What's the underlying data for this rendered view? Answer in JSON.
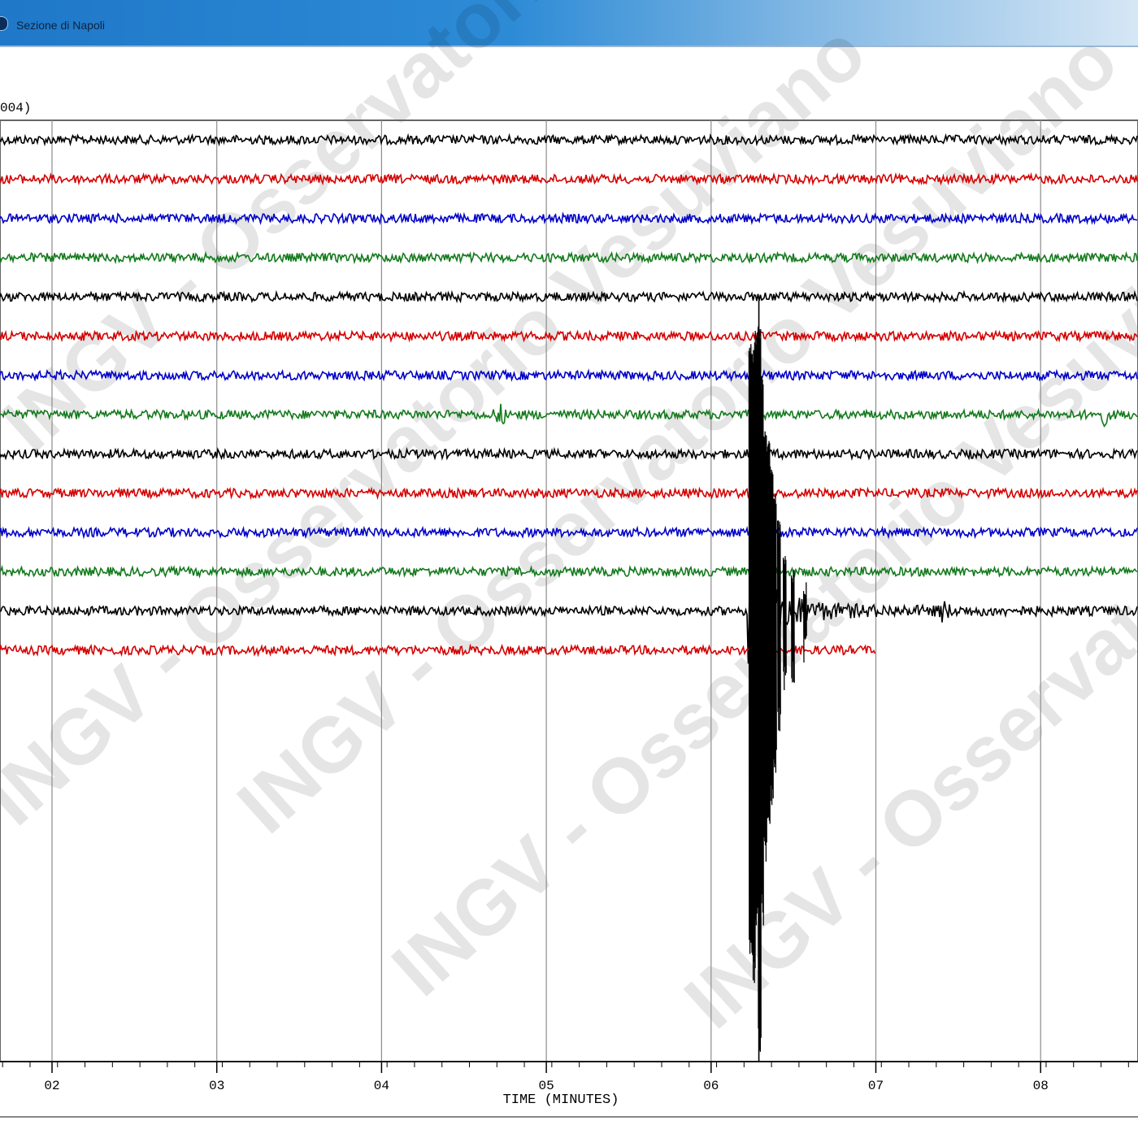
{
  "window": {
    "title": "Sezione di Napoli"
  },
  "header_label": "004)",
  "watermark_text": "INGV - Osservatorio Vesuviano",
  "chart_data": {
    "type": "line",
    "title": "",
    "xlabel": "TIME (MINUTES)",
    "ylabel": "",
    "x_ticks": [
      "02",
      "03",
      "04",
      "05",
      "06",
      "07",
      "08"
    ],
    "xlim": [
      1.7,
      8.6
    ],
    "grid": true,
    "trace_count": 14,
    "trace_color_cycle": [
      "#000000",
      "#d40000",
      "#0000c8",
      "#137a1c"
    ],
    "event": {
      "onset_minute": 6.22,
      "peak_minute": 6.29,
      "last_trace_ends_minute": 7.0,
      "color": "#000000"
    },
    "minor_spikes": [
      {
        "trace": 8,
        "minute": 4.72
      },
      {
        "trace": 8,
        "minute": 8.38
      },
      {
        "trace": 13,
        "minute": 7.41
      }
    ]
  }
}
